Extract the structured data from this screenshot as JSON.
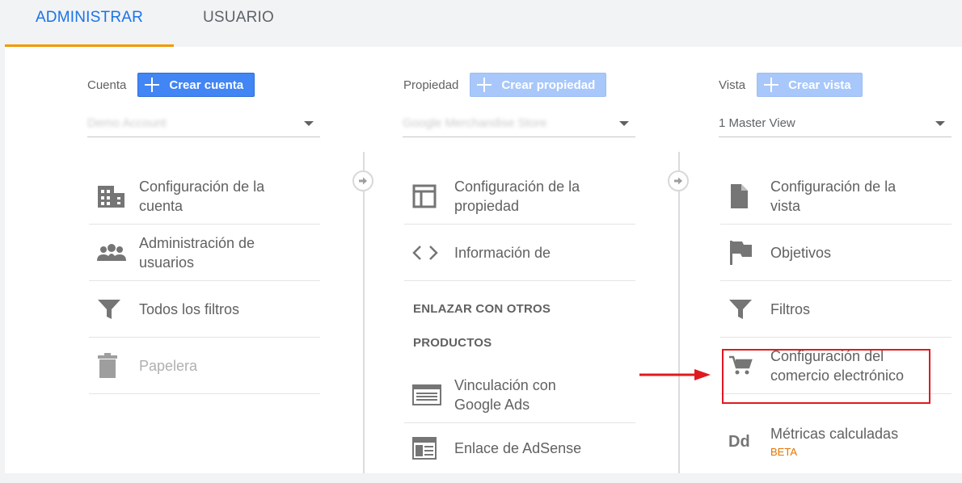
{
  "tabs": {
    "admin": "ADMINISTRAR",
    "user": "USUARIO"
  },
  "account": {
    "label": "Cuenta",
    "create_label": "Crear cuenta",
    "selected": "Demo Account",
    "items": [
      {
        "label": "Configuración de la cuenta",
        "icon": "building-icon"
      },
      {
        "label": "Administración de usuarios",
        "icon": "people-icon"
      },
      {
        "label": "Todos los filtros",
        "icon": "filter-icon"
      },
      {
        "label": "Papelera",
        "icon": "trash-icon"
      }
    ]
  },
  "property": {
    "label": "Propiedad",
    "create_label": "Crear propiedad",
    "selected": "Google Merchandise Store",
    "items": [
      {
        "label": "Configuración de la propiedad",
        "icon": "layout-icon"
      },
      {
        "label": "Información de",
        "icon": "code-icon"
      }
    ],
    "section_line1": "ENLAZAR CON OTROS",
    "section_line2": "PRODUCTOS",
    "linked": [
      {
        "label": "Vinculación con Google Ads",
        "icon": "ads-icon"
      },
      {
        "label": "Enlace de AdSense",
        "icon": "adsense-icon"
      }
    ]
  },
  "view": {
    "label": "Vista",
    "create_label": "Crear vista",
    "selected": "1 Master View",
    "items": [
      {
        "label": "Configuración de la vista",
        "icon": "document-icon"
      },
      {
        "label": "Objetivos",
        "icon": "flag-icon"
      },
      {
        "label": "Filtros",
        "icon": "filter-icon"
      },
      {
        "label": "Configuración del comercio electrónico",
        "icon": "cart-icon"
      },
      {
        "label": "Métricas calculadas",
        "icon": "dd-icon",
        "badge": "BETA"
      }
    ]
  },
  "colors": {
    "accent": "#4285f4",
    "tab_active": "#1a73e8",
    "tab_underline": "#f29900",
    "highlight": "#e0191f",
    "beta": "#e37400"
  }
}
